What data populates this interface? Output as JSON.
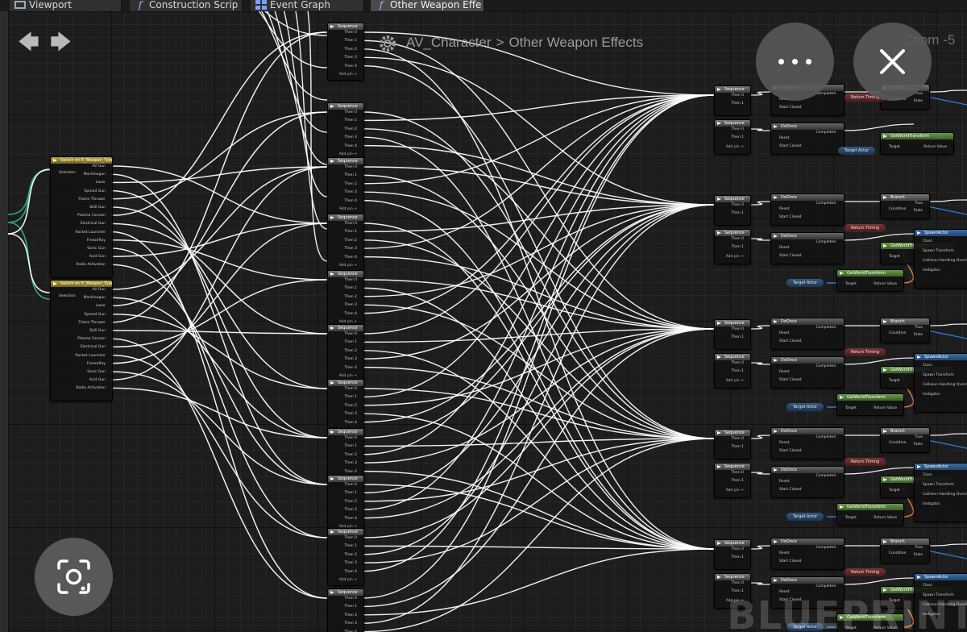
{
  "tabs": [
    {
      "label": "Viewport",
      "icon": "viewport-icon",
      "active": false
    },
    {
      "label": "Construction Scrip",
      "icon": "function-icon",
      "active": false
    },
    {
      "label": "Event Graph",
      "icon": "event-graph-icon",
      "active": false
    },
    {
      "label": "Other Weapon Effe",
      "icon": "function-icon",
      "active": true
    }
  ],
  "breadcrumb": {
    "root": "AV_Character",
    "separator": ">",
    "current": "Other Weapon Effects"
  },
  "zoom_label": "Zoom -5",
  "watermark": "BLUEPRINT",
  "switch_node": {
    "title": "Switch on E_Weapon_Type",
    "selection_pin": "Selection",
    "outputs": [
      "AV Gun",
      "Machinegun",
      "Laser",
      "Spread Gun",
      "Flame Thrower",
      "Skill Gun",
      "Plasma Cannon",
      "Electrical Gun",
      "Rocket Launcher",
      "FreezeRay",
      "Sonic Gun",
      "Acid Gun",
      "Radio Activation"
    ]
  },
  "sequence_node": {
    "title": "Sequence",
    "outputs": [
      "Then 0",
      "Then 1",
      "Then 2",
      "Then 3",
      "Then 4"
    ],
    "add_pin": "Add pin +"
  },
  "doonce_node": {
    "title": "DoOnce",
    "pins": [
      "Reset",
      "Start Closed"
    ],
    "completed": "Completed"
  },
  "branch_node": {
    "title": "Branch",
    "condition": "Condition",
    "true_pin": "True",
    "false_pin": "False"
  },
  "transform_node": {
    "title": "GetWorldTransform",
    "target": "Target",
    "return": "Return Value"
  },
  "spawn_node": {
    "title": "SpawnActor",
    "pins": [
      "Class",
      "Spawn Transform",
      "Collision Handling Override",
      "Instigator"
    ]
  },
  "getter_labels": {
    "target_actor": "Target Actor",
    "return_timing": "Return Timing"
  },
  "icons": {
    "back": "arrow-left-icon",
    "forward": "arrow-right-icon",
    "more": "more-dots-icon",
    "close": "close-icon",
    "lens": "lens-camera-icon",
    "gear": "gear-icon"
  }
}
